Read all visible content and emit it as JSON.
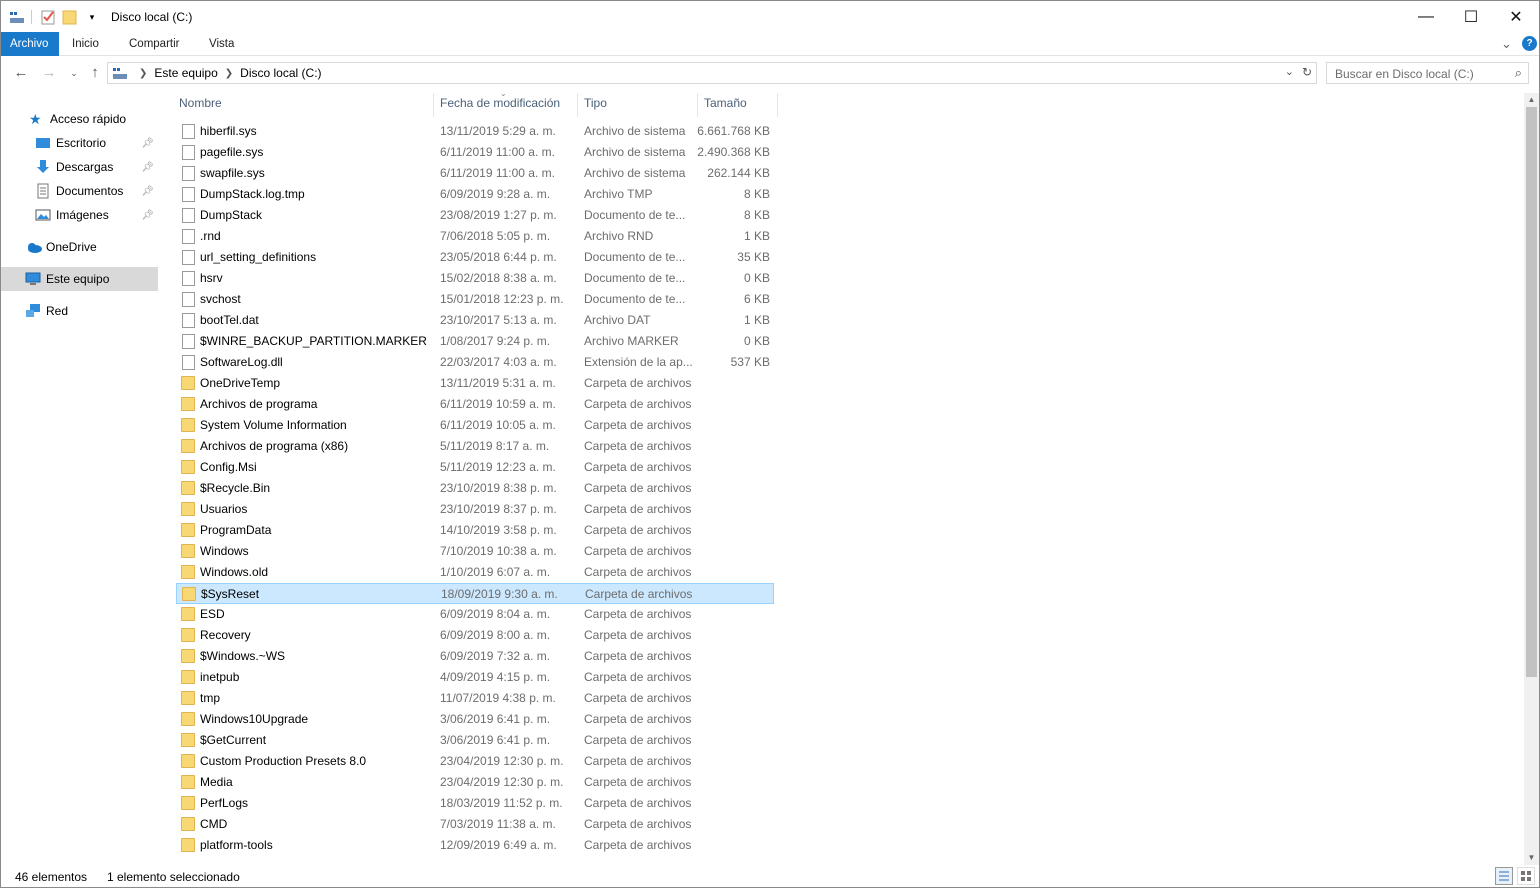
{
  "window": {
    "title": "Disco local (C:)",
    "minimize_icon": "—",
    "maximize_icon": "☐",
    "close_icon": "✕"
  },
  "ribbon": {
    "tabs": [
      {
        "label": "Archivo",
        "active": true
      },
      {
        "label": "Inicio"
      },
      {
        "label": "Compartir"
      },
      {
        "label": "Vista"
      }
    ],
    "expand_icon": "⌄",
    "help_icon": "?"
  },
  "address": {
    "crumbs": [
      "Este equipo",
      "Disco local (C:)"
    ],
    "search_placeholder": "Buscar en Disco local (C:)"
  },
  "nav": {
    "quick_access": "Acceso rápido",
    "items": [
      {
        "label": "Escritorio",
        "icon": "desktop-icon",
        "pinned": true
      },
      {
        "label": "Descargas",
        "icon": "downloads-icon",
        "pinned": true
      },
      {
        "label": "Documentos",
        "icon": "documents-icon",
        "pinned": true
      },
      {
        "label": "Imágenes",
        "icon": "pictures-icon",
        "pinned": true
      }
    ],
    "onedrive": "OneDrive",
    "this_pc": "Este equipo",
    "network": "Red"
  },
  "columns": {
    "name": "Nombre",
    "date": "Fecha de modificación",
    "type": "Tipo",
    "size": "Tamaño"
  },
  "files": [
    {
      "name": "hiberfil.sys",
      "date": "13/11/2019 5:29 a. m.",
      "type": "Archivo de sistema",
      "size": "6.661.768 KB",
      "kind": "file"
    },
    {
      "name": "pagefile.sys",
      "date": "6/11/2019 11:00 a. m.",
      "type": "Archivo de sistema",
      "size": "2.490.368 KB",
      "kind": "file"
    },
    {
      "name": "swapfile.sys",
      "date": "6/11/2019 11:00 a. m.",
      "type": "Archivo de sistema",
      "size": "262.144 KB",
      "kind": "file"
    },
    {
      "name": "DumpStack.log.tmp",
      "date": "6/09/2019 9:28 a. m.",
      "type": "Archivo TMP",
      "size": "8 KB",
      "kind": "file"
    },
    {
      "name": "DumpStack",
      "date": "23/08/2019 1:27 p. m.",
      "type": "Documento de te...",
      "size": "8 KB",
      "kind": "file"
    },
    {
      "name": ".rnd",
      "date": "7/06/2018 5:05 p. m.",
      "type": "Archivo RND",
      "size": "1 KB",
      "kind": "file"
    },
    {
      "name": "url_setting_definitions",
      "date": "23/05/2018 6:44 p. m.",
      "type": "Documento de te...",
      "size": "35 KB",
      "kind": "file"
    },
    {
      "name": "hsrv",
      "date": "15/02/2018 8:38 a. m.",
      "type": "Documento de te...",
      "size": "0 KB",
      "kind": "file"
    },
    {
      "name": "svchost",
      "date": "15/01/2018 12:23 p. m.",
      "type": "Documento de te...",
      "size": "6 KB",
      "kind": "file"
    },
    {
      "name": "bootTel.dat",
      "date": "23/10/2017 5:13 a. m.",
      "type": "Archivo DAT",
      "size": "1 KB",
      "kind": "file"
    },
    {
      "name": "$WINRE_BACKUP_PARTITION.MARKER",
      "date": "1/08/2017 9:24 p. m.",
      "type": "Archivo MARKER",
      "size": "0 KB",
      "kind": "file"
    },
    {
      "name": "SoftwareLog.dll",
      "date": "22/03/2017 4:03 a. m.",
      "type": "Extensión de la ap...",
      "size": "537 KB",
      "kind": "file"
    },
    {
      "name": "OneDriveTemp",
      "date": "13/11/2019 5:31 a. m.",
      "type": "Carpeta de archivos",
      "size": "",
      "kind": "folder"
    },
    {
      "name": "Archivos de programa",
      "date": "6/11/2019 10:59 a. m.",
      "type": "Carpeta de archivos",
      "size": "",
      "kind": "folder"
    },
    {
      "name": "System Volume Information",
      "date": "6/11/2019 10:05 a. m.",
      "type": "Carpeta de archivos",
      "size": "",
      "kind": "folder"
    },
    {
      "name": "Archivos de programa (x86)",
      "date": "5/11/2019 8:17 a. m.",
      "type": "Carpeta de archivos",
      "size": "",
      "kind": "folder"
    },
    {
      "name": "Config.Msi",
      "date": "5/11/2019 12:23 a. m.",
      "type": "Carpeta de archivos",
      "size": "",
      "kind": "folder"
    },
    {
      "name": "$Recycle.Bin",
      "date": "23/10/2019 8:38 p. m.",
      "type": "Carpeta de archivos",
      "size": "",
      "kind": "folder"
    },
    {
      "name": "Usuarios",
      "date": "23/10/2019 8:37 p. m.",
      "type": "Carpeta de archivos",
      "size": "",
      "kind": "folder"
    },
    {
      "name": "ProgramData",
      "date": "14/10/2019 3:58 p. m.",
      "type": "Carpeta de archivos",
      "size": "",
      "kind": "folder"
    },
    {
      "name": "Windows",
      "date": "7/10/2019 10:38 a. m.",
      "type": "Carpeta de archivos",
      "size": "",
      "kind": "folder"
    },
    {
      "name": "Windows.old",
      "date": "1/10/2019 6:07 a. m.",
      "type": "Carpeta de archivos",
      "size": "",
      "kind": "folder"
    },
    {
      "name": "$SysReset",
      "date": "18/09/2019 9:30 a. m.",
      "type": "Carpeta de archivos",
      "size": "",
      "kind": "folder",
      "selected": true
    },
    {
      "name": "ESD",
      "date": "6/09/2019 8:04 a. m.",
      "type": "Carpeta de archivos",
      "size": "",
      "kind": "folder"
    },
    {
      "name": "Recovery",
      "date": "6/09/2019 8:00 a. m.",
      "type": "Carpeta de archivos",
      "size": "",
      "kind": "folder"
    },
    {
      "name": "$Windows.~WS",
      "date": "6/09/2019 7:32 a. m.",
      "type": "Carpeta de archivos",
      "size": "",
      "kind": "folder"
    },
    {
      "name": "inetpub",
      "date": "4/09/2019 4:15 p. m.",
      "type": "Carpeta de archivos",
      "size": "",
      "kind": "folder"
    },
    {
      "name": "tmp",
      "date": "11/07/2019 4:38 p. m.",
      "type": "Carpeta de archivos",
      "size": "",
      "kind": "folder"
    },
    {
      "name": "Windows10Upgrade",
      "date": "3/06/2019 6:41 p. m.",
      "type": "Carpeta de archivos",
      "size": "",
      "kind": "folder"
    },
    {
      "name": "$GetCurrent",
      "date": "3/06/2019 6:41 p. m.",
      "type": "Carpeta de archivos",
      "size": "",
      "kind": "folder"
    },
    {
      "name": "Custom Production Presets 8.0",
      "date": "23/04/2019 12:30 p. m.",
      "type": "Carpeta de archivos",
      "size": "",
      "kind": "folder"
    },
    {
      "name": "Media",
      "date": "23/04/2019 12:30 p. m.",
      "type": "Carpeta de archivos",
      "size": "",
      "kind": "folder"
    },
    {
      "name": "PerfLogs",
      "date": "18/03/2019 11:52 p. m.",
      "type": "Carpeta de archivos",
      "size": "",
      "kind": "folder"
    },
    {
      "name": "CMD",
      "date": "7/03/2019 11:38 a. m.",
      "type": "Carpeta de archivos",
      "size": "",
      "kind": "folder"
    },
    {
      "name": "platform-tools",
      "date": "12/09/2019 6:49 a. m.",
      "type": "Carpeta de archivos",
      "size": "",
      "kind": "folder"
    }
  ],
  "status": {
    "count": "46 elementos",
    "selection": "1 elemento seleccionado"
  },
  "colors": {
    "accent": "#1979ca",
    "selection_bg": "#cce8ff",
    "selection_border": "#99d1ff",
    "folder": "#f8d775"
  }
}
